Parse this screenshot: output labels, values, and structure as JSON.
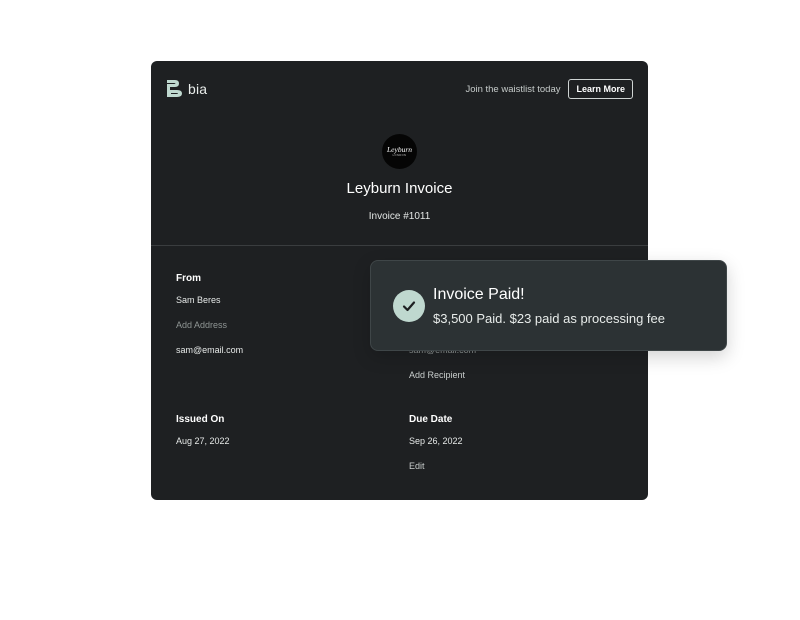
{
  "header": {
    "brand_name": "bia",
    "waitlist_text": "Join the waistlist today",
    "learn_more_label": "Learn More"
  },
  "invoice": {
    "logo_text": "Leyburn",
    "logo_subtext": "LONDON",
    "title": "Leyburn Invoice",
    "number": "Invoice #1011"
  },
  "from": {
    "heading": "From",
    "name": "Sam Beres",
    "address_placeholder": "Add Address",
    "email": "sam@email.com"
  },
  "to": {
    "email_partial": "sam@email.com",
    "add_recipient_label": "Add Recipient"
  },
  "issued": {
    "heading": "Issued On",
    "date": "Aug 27, 2022"
  },
  "due": {
    "heading": "Due Date",
    "date": "Sep 26, 2022",
    "edit_label": "Edit"
  },
  "toast": {
    "title": "Invoice Paid!",
    "message": "$3,500  Paid. $23 paid as processing fee"
  },
  "colors": {
    "card_bg": "#1e2022",
    "toast_bg": "#2c3234",
    "accent_mint": "#bfd8cf"
  }
}
